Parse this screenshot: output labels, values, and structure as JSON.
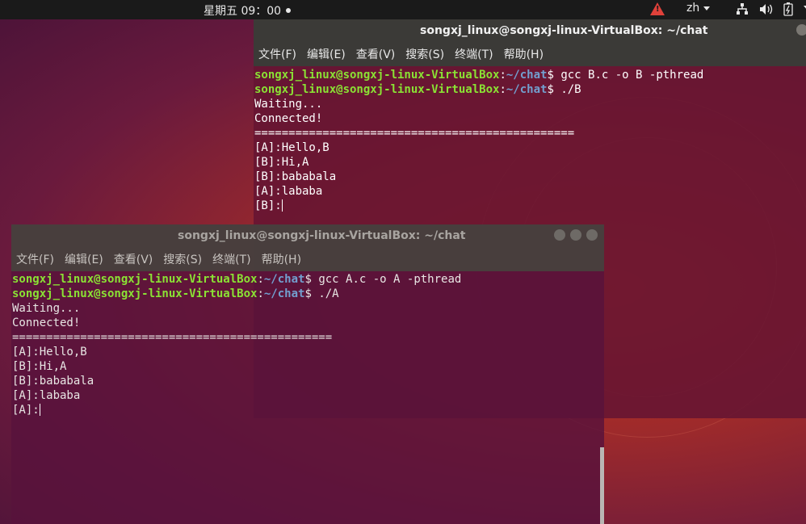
{
  "topbar": {
    "clock": "星期五 09：00",
    "language": "zh",
    "icons": [
      "warning-icon",
      "network-icon",
      "volume-icon",
      "battery-icon",
      "power-menu-icon"
    ]
  },
  "terminal_b": {
    "title": "songxj_linux@songxj-linux-VirtualBox: ~/chat",
    "menu": [
      "文件(F)",
      "编辑(E)",
      "查看(V)",
      "搜索(S)",
      "终端(T)",
      "帮助(H)"
    ],
    "prompt_user": "songxj_linux@songxj-linux-VirtualBox",
    "prompt_path": "~/chat",
    "commands": [
      "gcc B.c -o B -pthread",
      "./B"
    ],
    "output": [
      "Waiting...",
      "Connected!",
      "===============================================",
      "[A]:Hello,B",
      "[B]:Hi,A",
      "[B]:bababala",
      "[A]:lababa"
    ],
    "input_prompt": "[B]:"
  },
  "terminal_a": {
    "title": "songxj_linux@songxj-linux-VirtualBox: ~/chat",
    "menu": [
      "文件(F)",
      "编辑(E)",
      "查看(V)",
      "搜索(S)",
      "终端(T)",
      "帮助(H)"
    ],
    "prompt_user": "songxj_linux@songxj-linux-VirtualBox",
    "prompt_path": "~/chat",
    "commands": [
      "gcc A.c -o A -pthread",
      "./A"
    ],
    "output": [
      "Waiting...",
      "Connected!",
      "===============================================",
      "[A]:Hello,B",
      "[B]:Hi,A",
      "[B]:bababala",
      "[A]:lababa"
    ],
    "input_prompt": "[A]:"
  },
  "colors": {
    "prompt_user": "#8ae234",
    "prompt_path": "#729fcf",
    "warning": "#e0413a"
  }
}
